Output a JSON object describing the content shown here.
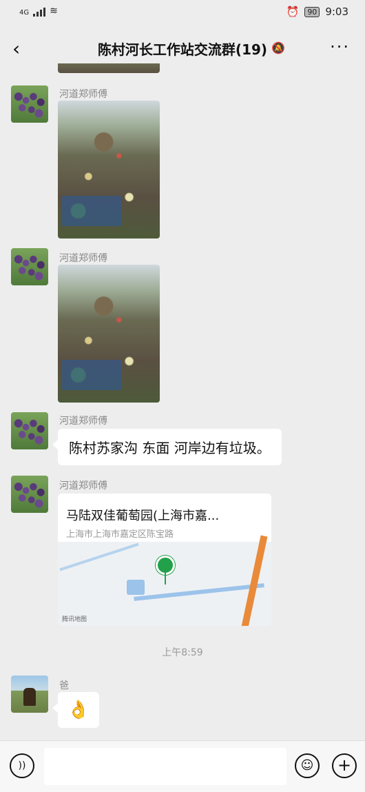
{
  "status_bar": {
    "network": "4G",
    "battery": "90",
    "time": "9:03"
  },
  "header": {
    "title": "陈村河长工作站交流群(19)",
    "back_icon": "chevron-left-icon",
    "mute_icon": "bell-off-icon",
    "more_label": "···"
  },
  "messages": [
    {
      "sender": "河道郑师傅",
      "type": "image"
    },
    {
      "sender": "河道郑师傅",
      "type": "image"
    },
    {
      "sender": "河道郑师傅",
      "type": "text",
      "text": "陈村苏家沟 东面 河岸边有垃圾。"
    },
    {
      "sender": "河道郑师傅",
      "type": "location",
      "place": "马陆双佳葡萄园(上海市嘉...",
      "address": "上海市上海市嘉定区陈宝路",
      "map_credit": "腾讯地图"
    }
  ],
  "timestamp": "上午8:59",
  "last_message": {
    "sender": "爸",
    "type": "emoji",
    "emoji": "👌"
  },
  "input_bar": {
    "voice_icon": "voice-icon",
    "emoji_icon": "emoji-icon",
    "plus_icon": "plus-icon",
    "voice_glyph": "))",
    "emoji_glyph": "☺",
    "plus_glyph": "+"
  }
}
